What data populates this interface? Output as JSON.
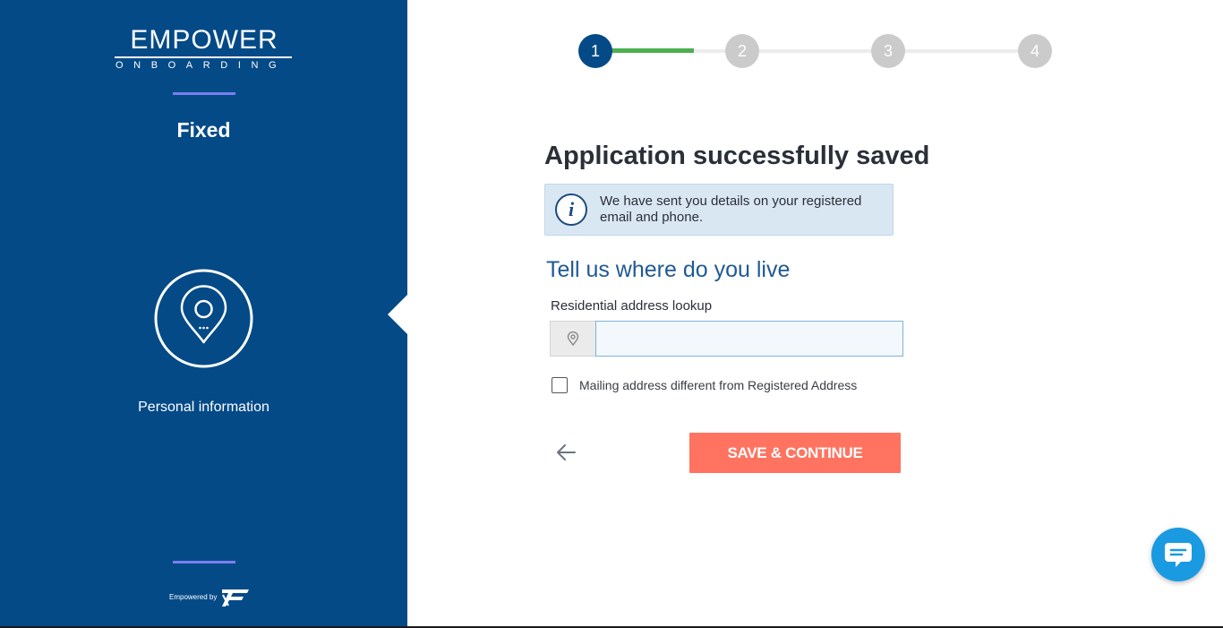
{
  "brand": {
    "logo_main": "EMPOWER",
    "logo_sub": "ONBOARDING",
    "powered_by": "Empowered by"
  },
  "sidebar": {
    "product_title": "Fixed",
    "step_icon": "map-pin-icon",
    "step_caption": "Personal information",
    "background": "#044a87",
    "accent": "#7a7ff0"
  },
  "stepper": {
    "steps": [
      "1",
      "2",
      "3",
      "4"
    ],
    "current": 1,
    "progress_color": "#4caf50",
    "active_color": "#044a87",
    "inactive_color": "#cbcbcb"
  },
  "main": {
    "title": "Application successfully saved",
    "info": {
      "icon": "info-icon",
      "text": "We have sent you details on your registered email and phone."
    },
    "section_heading": "Tell us where do you live",
    "address": {
      "label": "Residential address lookup",
      "icon": "location-pin-icon",
      "value": "",
      "placeholder": ""
    },
    "mailing_checkbox": {
      "label": "Mailing address different from Registered Address",
      "checked": false
    },
    "back_icon": "arrow-left-icon",
    "save_label": "SAVE & CONTINUE",
    "save_color": "#ff7360"
  },
  "chat": {
    "icon": "chat-bubble-icon",
    "color": "#1a9ae0"
  }
}
